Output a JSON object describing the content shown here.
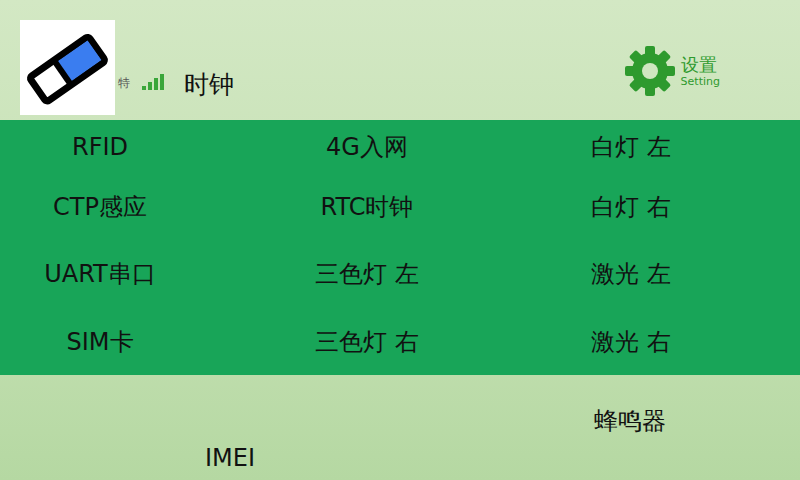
{
  "header": {
    "logo_text": "特",
    "signal": {
      "bars": 4,
      "filled": 4
    },
    "title": "时钟"
  },
  "settings": {
    "label": "设置",
    "sublabel": "Setting"
  },
  "grid": {
    "items": [
      {
        "label": "RFID"
      },
      {
        "label": "4G入网"
      },
      {
        "label": "白灯 左"
      },
      {
        "label": "CTP感应"
      },
      {
        "label": "RTC时钟"
      },
      {
        "label": "白灯 右"
      },
      {
        "label": "UART串口"
      },
      {
        "label": "三色灯 左"
      },
      {
        "label": "激光 左"
      },
      {
        "label": "SIM卡"
      },
      {
        "label": "三色灯 右"
      },
      {
        "label": "激光 右"
      }
    ]
  },
  "footer": {
    "items": [
      {
        "label": "IMEI"
      },
      {
        "label": "蜂鸣器"
      }
    ]
  }
}
